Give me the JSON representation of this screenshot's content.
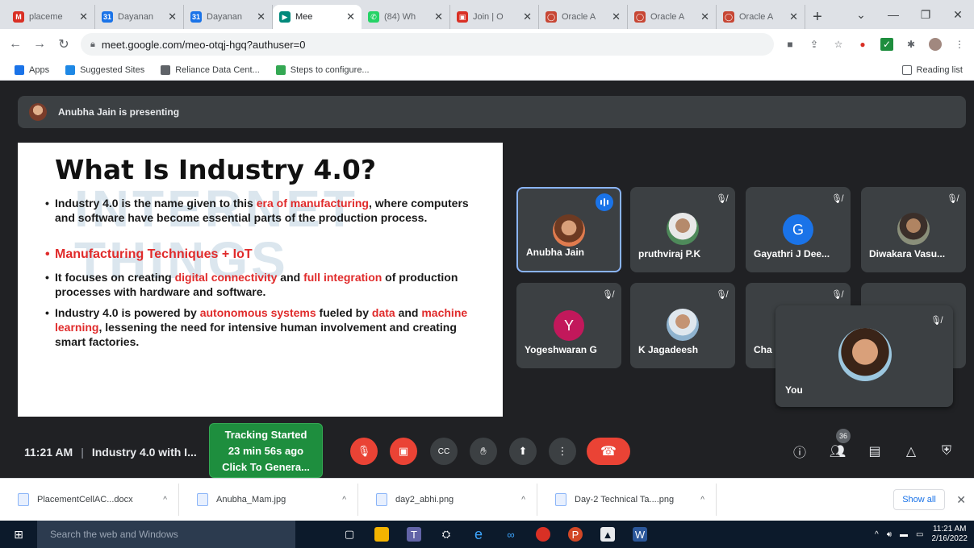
{
  "browser": {
    "tabs": [
      {
        "label": "placeme",
        "icon": "gmail-icon",
        "color": "#d93025",
        "glyph": "M"
      },
      {
        "label": "Dayanan",
        "icon": "calendar-icon",
        "color": "#1a73e8",
        "glyph": "31"
      },
      {
        "label": "Dayanan",
        "icon": "calendar-icon",
        "color": "#1a73e8",
        "glyph": "31"
      },
      {
        "label": "Mee",
        "icon": "meet-icon",
        "color": "#00897b",
        "glyph": "▶"
      },
      {
        "label": "(84) Wh",
        "icon": "whatsapp-icon",
        "color": "#25d366",
        "glyph": "✆"
      },
      {
        "label": "Join | O",
        "icon": "join-icon",
        "color": "#d93025",
        "glyph": "▣"
      },
      {
        "label": "Oracle A",
        "icon": "oracle-icon",
        "color": "#c74634",
        "glyph": "◯"
      },
      {
        "label": "Oracle A",
        "icon": "oracle-icon",
        "color": "#c74634",
        "glyph": "◯"
      },
      {
        "label": "Oracle A",
        "icon": "oracle-icon",
        "color": "#c74634",
        "glyph": "◯"
      }
    ],
    "active_tab": 3,
    "url": "meet.google.com/meo-otqj-hgq?authuser=0",
    "bookmarks": [
      {
        "label": "Apps",
        "color": "#1a73e8"
      },
      {
        "label": "Suggested Sites",
        "color": "#1e88e5"
      },
      {
        "label": "Reliance Data Cent...",
        "color": "#5f6368"
      },
      {
        "label": "Steps to configure...",
        "color": "#34a853"
      }
    ],
    "reading_list": "Reading list"
  },
  "meet": {
    "presenting_text": "Anubha Jain is presenting",
    "slide": {
      "title": "What Is Industry 4.0?",
      "watermark": "INTERNET\nTHINGS",
      "bullet1_a": "Industry 4.0 is the name given to this ",
      "bullet1_red": "era of manufacturing",
      "bullet1_b": ", where computers and software have become essential parts of the production process.",
      "bullet2_red": "Manufacturing Techniques + IoT",
      "bullet3_a": "It focuses on creating ",
      "bullet3_red1": "digital connectivity",
      "bullet3_b": " and ",
      "bullet3_red2": "full integration",
      "bullet3_c": " of production processes with hardware and software.",
      "bullet4_a": "Industry 4.0 is powered by  ",
      "bullet4_red1": "autonomous systems",
      "bullet4_b": " fueled by ",
      "bullet4_red2": "data",
      "bullet4_c": " and ",
      "bullet4_red3": "machine learning",
      "bullet4_d": ", lessening the need for intensive human involvement and creating smart factories."
    },
    "participants": [
      {
        "name": "Anubha Jain",
        "type": "photo"
      },
      {
        "name": "pruthviraj P.K",
        "type": "photo"
      },
      {
        "name": "Gayathri J Dee...",
        "type": "initial",
        "initial": "G",
        "color": "#1a73e8"
      },
      {
        "name": "Diwakara Vasu...",
        "type": "photo"
      },
      {
        "name": "Yogeshwaran G",
        "type": "initial",
        "initial": "Y",
        "color": "#c2185b"
      },
      {
        "name": "K Jagadeesh",
        "type": "photo"
      },
      {
        "name": "Cha",
        "type": "hidden"
      }
    ],
    "self_label": "You",
    "time": "11:21 AM",
    "meeting_title": "Industry 4.0 with I...",
    "tracking": [
      "Tracking Started",
      "23 min 56s ago",
      "Click To Genera..."
    ],
    "people_count": "36",
    "controls": [
      "mic-off",
      "camera-off",
      "captions",
      "raise-hand",
      "present",
      "more-options",
      "end-call"
    ]
  },
  "downloads": {
    "items": [
      "PlacementCellAC...docx",
      "Anubha_Mam.jpg",
      "day2_abhi.png",
      "Day-2 Technical Ta....png"
    ],
    "show_all": "Show all"
  },
  "taskbar": {
    "search_placeholder": "Search the web and Windows",
    "time": "11:21 AM",
    "date": "2/16/2022"
  }
}
